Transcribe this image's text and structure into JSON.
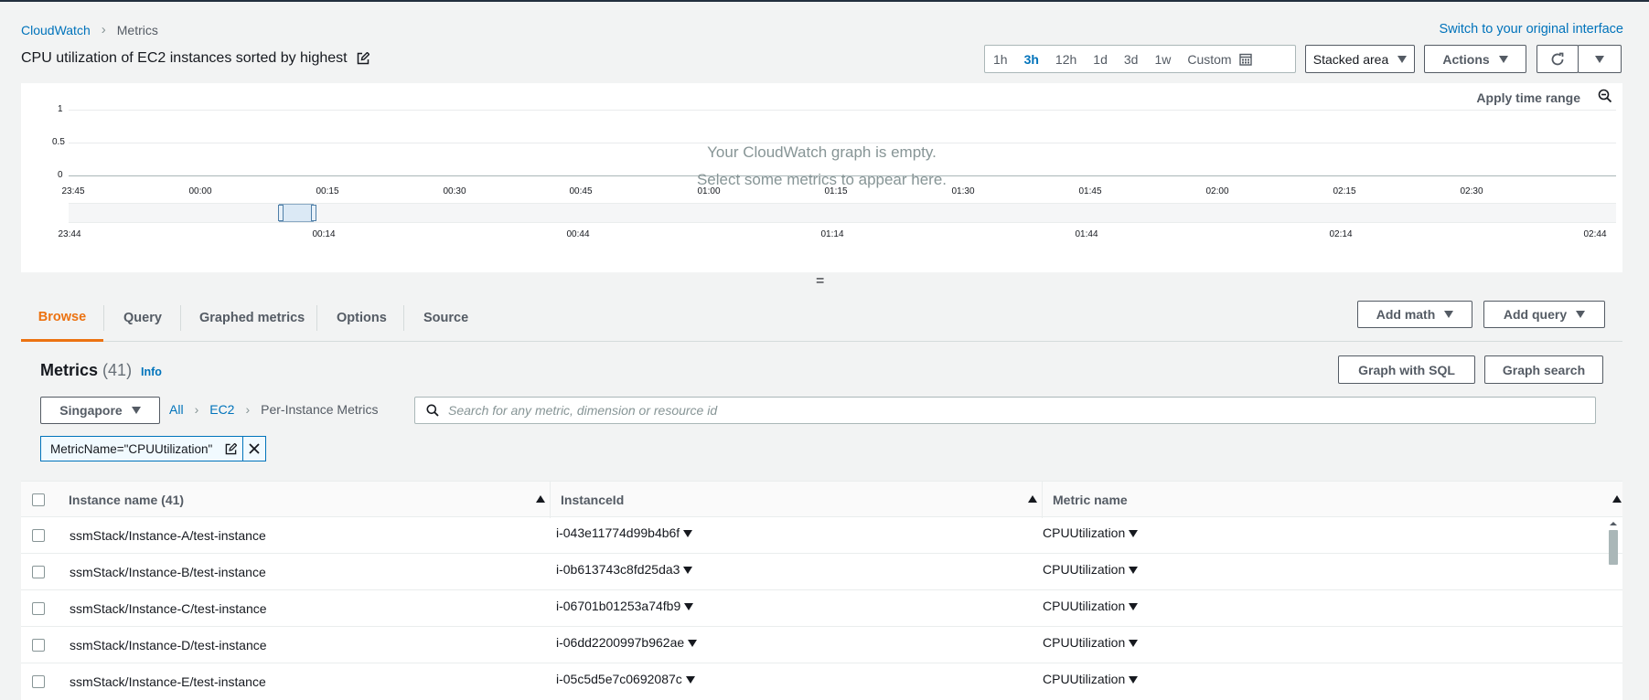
{
  "breadcrumb": {
    "root": "CloudWatch",
    "current": "Metrics"
  },
  "header": {
    "switch_link": "Switch to your original interface",
    "title": "CPU utilization of EC2 instances sorted by highest"
  },
  "time_range": {
    "options": [
      "1h",
      "3h",
      "12h",
      "1d",
      "3d",
      "1w"
    ],
    "active": "3h",
    "custom_label": "Custom"
  },
  "toolbar": {
    "chart_type": "Stacked area",
    "actions_label": "Actions"
  },
  "graph": {
    "apply_time_range": "Apply time range",
    "empty_line1": "Your CloudWatch graph is empty.",
    "empty_line2": "Select some metrics to appear here.",
    "y_ticks": [
      "1",
      "0.5",
      "0"
    ],
    "x_ticks": [
      "23:45",
      "00:00",
      "00:15",
      "00:30",
      "00:45",
      "01:00",
      "01:15",
      "01:30",
      "01:45",
      "02:00",
      "02:15",
      "02:30"
    ],
    "nav_ticks": [
      "23:44",
      "00:14",
      "00:44",
      "01:14",
      "01:44",
      "02:14",
      "02:44"
    ]
  },
  "tabs": [
    "Browse",
    "Query",
    "Graphed metrics",
    "Options",
    "Source"
  ],
  "tab_buttons": {
    "add_math": "Add math",
    "add_query": "Add query"
  },
  "metrics": {
    "title": "Metrics",
    "count": "(41)",
    "info": "Info",
    "graph_with_sql": "Graph with SQL",
    "graph_search": "Graph search",
    "region": "Singapore",
    "crumbs": [
      "All",
      "EC2",
      "Per-Instance Metrics"
    ],
    "search_placeholder": "Search for any metric, dimension or resource id",
    "filter_token": "MetricName=\"CPUUtilization\""
  },
  "table": {
    "headers": {
      "name": "Instance name",
      "name_count": "(41)",
      "instance_id": "InstanceId",
      "metric": "Metric name"
    },
    "rows": [
      {
        "name": "ssmStack/Instance-A/test-instance",
        "id": "i-043e11774d99b4b6f",
        "metric": "CPUUtilization"
      },
      {
        "name": "ssmStack/Instance-B/test-instance",
        "id": "i-0b613743c8fd25da3",
        "metric": "CPUUtilization"
      },
      {
        "name": "ssmStack/Instance-C/test-instance",
        "id": "i-06701b01253a74fb9",
        "metric": "CPUUtilization"
      },
      {
        "name": "ssmStack/Instance-D/test-instance",
        "id": "i-06dd2200997b962ae",
        "metric": "CPUUtilization"
      },
      {
        "name": "ssmStack/Instance-E/test-instance",
        "id": "i-05c5d5e7c0692087c",
        "metric": "CPUUtilization"
      }
    ]
  },
  "colors": {
    "accent": "#ec7211",
    "link": "#0073bb",
    "border": "#545b64"
  }
}
